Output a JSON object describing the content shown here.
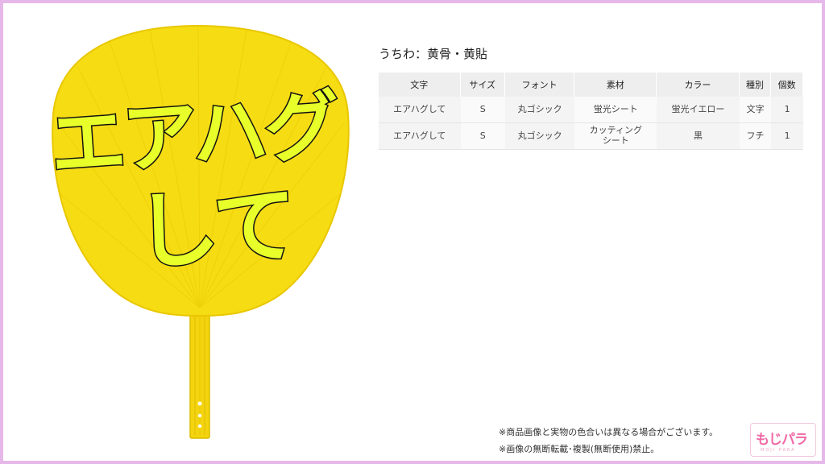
{
  "fan": {
    "text_line1": "エアハグ",
    "text_line2": "して",
    "colors": {
      "fan_fill": "#f6dc13",
      "fan_edge": "#e9c700",
      "letter_fill": "#e8ff2a",
      "letter_outline": "#111111"
    }
  },
  "product": {
    "title": "うちわ：黄骨・黄貼"
  },
  "spec_table": {
    "headers": [
      "文字",
      "サイズ",
      "フォント",
      "素材",
      "カラー",
      "種別",
      "個数"
    ],
    "rows": [
      [
        "エアハグして",
        "S",
        "丸ゴシック",
        "蛍光シート",
        "蛍光イエロー",
        "文字",
        "1"
      ],
      [
        "エアハグして",
        "S",
        "丸ゴシック",
        "カッティング\nシート",
        "黒",
        "フチ",
        "1"
      ]
    ]
  },
  "notes": {
    "line1": "※商品画像と実物の色合いは異なる場合がございます。",
    "line2": "※画像の無断転載･複製(無断使用)禁止。"
  },
  "logo": {
    "text": "もじパラ",
    "sub": "MOJI PARA",
    "color": "#f06aa6"
  },
  "frame": {
    "border_color": "#e6b8ea"
  }
}
